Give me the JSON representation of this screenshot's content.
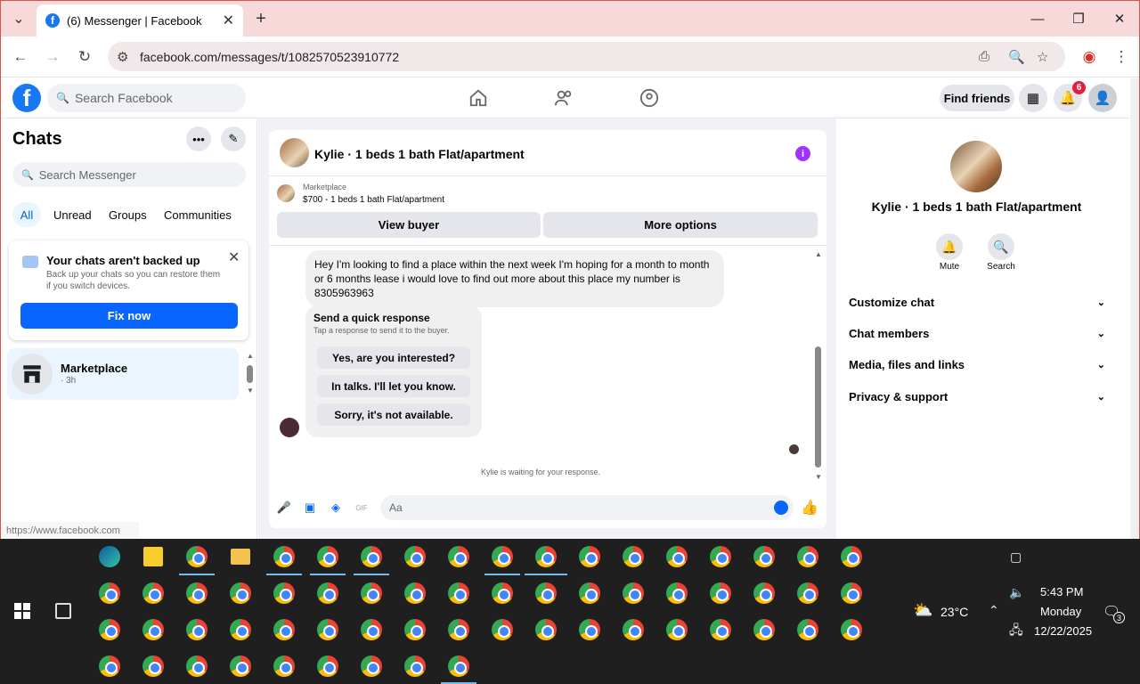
{
  "browser": {
    "tab_title": "(6) Messenger | Facebook",
    "favicon_letter": "f",
    "url": "facebook.com/messages/t/1082570523910772",
    "status_url": "https://www.facebook.com"
  },
  "fb": {
    "logo_letter": "f",
    "search_placeholder": "Search Facebook",
    "find_friends": "Find friends",
    "notification_count": "6"
  },
  "left": {
    "title": "Chats",
    "search_placeholder": "Search Messenger",
    "filters": [
      "All",
      "Unread",
      "Groups",
      "Communities"
    ],
    "backup": {
      "title": "Your chats aren't backed up",
      "desc": "Back up your chats so you can restore them if you switch devices.",
      "button": "Fix now"
    },
    "chat_item": {
      "name": "Marketplace",
      "time": "· 3h"
    }
  },
  "chat": {
    "header_name": "Kylie · 1 beds 1 bath Flat/apartment",
    "listing_label": "Marketplace",
    "listing_price": "$700 - 1 beds 1 bath Flat/apartment",
    "view_buyer": "View buyer",
    "more_options": "More options",
    "message": "Hey I'm looking to find a place within the next week I'm hoping for a month to month or 6 months lease i would love to find out more about this place my number is  8305963963",
    "quick_title": "Send a quick response",
    "quick_sub": "Tap a response to send it to the buyer.",
    "quick_options": [
      "Yes, are you interested?",
      "In talks. I'll let you know.",
      "Sorry, it's not available."
    ],
    "waiting": "Kylie is waiting for your response.",
    "composer_placeholder": "Aa"
  },
  "right": {
    "name": "Kylie · 1 beds 1 bath Flat/apartment",
    "mute": "Mute",
    "search": "Search",
    "sections": [
      "Customize chat",
      "Chat members",
      "Media, files and links",
      "Privacy & support"
    ]
  },
  "taskbar": {
    "temperature": "23°C",
    "time": "5:43 PM",
    "day": "Monday",
    "date": "12/22/2025",
    "notif_count": "3"
  },
  "colors": {
    "fb_blue": "#1877f2",
    "button_blue": "#0866ff",
    "info_purple": "#a033ff",
    "badge_red": "#e41e3f"
  }
}
